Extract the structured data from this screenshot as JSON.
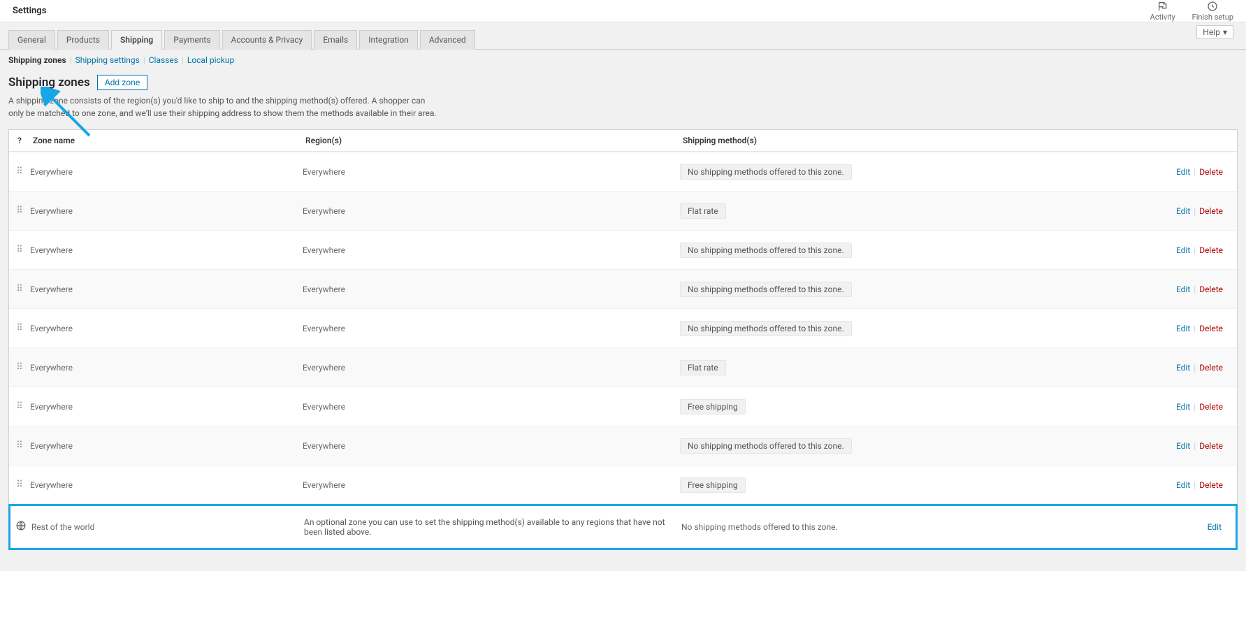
{
  "topbar": {
    "title": "Settings",
    "activity": "Activity",
    "finish_setup": "Finish setup"
  },
  "help_label": "Help",
  "tabs": [
    {
      "label": "General",
      "active": false
    },
    {
      "label": "Products",
      "active": false
    },
    {
      "label": "Shipping",
      "active": true
    },
    {
      "label": "Payments",
      "active": false
    },
    {
      "label": "Accounts & Privacy",
      "active": false
    },
    {
      "label": "Emails",
      "active": false
    },
    {
      "label": "Integration",
      "active": false
    },
    {
      "label": "Advanced",
      "active": false
    }
  ],
  "subnav": [
    {
      "label": "Shipping zones",
      "current": true
    },
    {
      "label": "Shipping settings",
      "current": false
    },
    {
      "label": "Classes",
      "current": false
    },
    {
      "label": "Local pickup",
      "current": false
    }
  ],
  "page": {
    "heading": "Shipping zones",
    "add_zone_label": "Add zone",
    "description": "A shipping zone consists of the region(s) you'd like to ship to and the shipping method(s) offered. A shopper can only be matched to one zone, and we'll use their shipping address to show them the methods available in their area."
  },
  "columns": {
    "zone_name": "Zone name",
    "regions": "Region(s)",
    "shipping_methods": "Shipping method(s)"
  },
  "actions": {
    "edit": "Edit",
    "delete": "Delete"
  },
  "zones": [
    {
      "name": "Everywhere",
      "region": "Everywhere",
      "method": "No shipping methods offered to this zone."
    },
    {
      "name": "Everywhere",
      "region": "Everywhere",
      "method": "Flat rate"
    },
    {
      "name": "Everywhere",
      "region": "Everywhere",
      "method": "No shipping methods offered to this zone."
    },
    {
      "name": "Everywhere",
      "region": "Everywhere",
      "method": "No shipping methods offered to this zone."
    },
    {
      "name": "Everywhere",
      "region": "Everywhere",
      "method": "No shipping methods offered to this zone."
    },
    {
      "name": "Everywhere",
      "region": "Everywhere",
      "method": "Flat rate"
    },
    {
      "name": "Everywhere",
      "region": "Everywhere",
      "method": "Free shipping"
    },
    {
      "name": "Everywhere",
      "region": "Everywhere",
      "method": "No shipping methods offered to this zone."
    },
    {
      "name": "Everywhere",
      "region": "Everywhere",
      "method": "Free shipping"
    }
  ],
  "rest_of_world": {
    "name": "Rest of the world",
    "desc": "An optional zone you can use to set the shipping method(s) available to any regions that have not been listed above.",
    "method": "No shipping methods offered to this zone."
  }
}
